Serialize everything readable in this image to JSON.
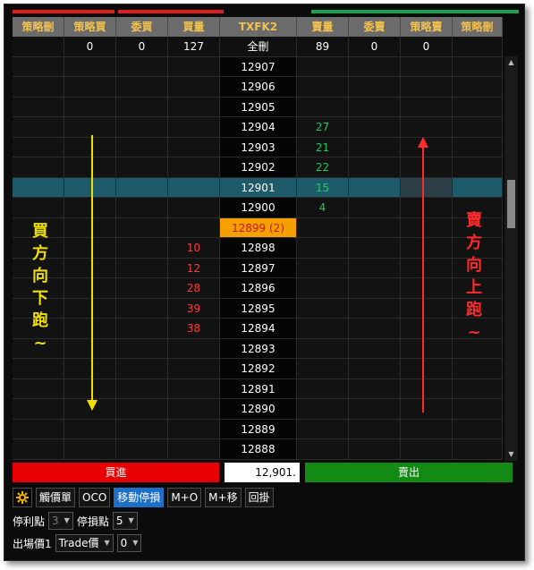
{
  "header": [
    "策略刪",
    "策略買",
    "委買",
    "買量",
    "TXFK2",
    "賣量",
    "委賣",
    "策略賣",
    "策略刪"
  ],
  "summary": [
    "",
    "0",
    "0",
    "127",
    "全刪",
    "89",
    "0",
    "0",
    ""
  ],
  "rows": [
    {
      "price": "12907",
      "bid_qty": "",
      "ask_qty": ""
    },
    {
      "price": "12906",
      "bid_qty": "",
      "ask_qty": ""
    },
    {
      "price": "12905",
      "bid_qty": "",
      "ask_qty": ""
    },
    {
      "price": "12904",
      "bid_qty": "",
      "ask_qty": "27"
    },
    {
      "price": "12903",
      "bid_qty": "",
      "ask_qty": "21"
    },
    {
      "price": "12902",
      "bid_qty": "",
      "ask_qty": "22"
    },
    {
      "price": "12901",
      "bid_qty": "",
      "ask_qty": "15"
    },
    {
      "price": "12900",
      "bid_qty": "",
      "ask_qty": "4"
    },
    {
      "price": "12899 (2)",
      "bid_qty": "",
      "ask_qty": ""
    },
    {
      "price": "12898",
      "bid_qty": "10",
      "ask_qty": ""
    },
    {
      "price": "12897",
      "bid_qty": "12",
      "ask_qty": ""
    },
    {
      "price": "12896",
      "bid_qty": "28",
      "ask_qty": ""
    },
    {
      "price": "12895",
      "bid_qty": "39",
      "ask_qty": ""
    },
    {
      "price": "12894",
      "bid_qty": "38",
      "ask_qty": ""
    },
    {
      "price": "12893",
      "bid_qty": "",
      "ask_qty": ""
    },
    {
      "price": "12892",
      "bid_qty": "",
      "ask_qty": ""
    },
    {
      "price": "12891",
      "bid_qty": "",
      "ask_qty": ""
    },
    {
      "price": "12890",
      "bid_qty": "",
      "ask_qty": ""
    },
    {
      "price": "12889",
      "bid_qty": "",
      "ask_qty": ""
    },
    {
      "price": "12888",
      "bid_qty": "",
      "ask_qty": ""
    }
  ],
  "annotations": {
    "buy_text": [
      "買",
      "方",
      "向",
      "下",
      "跑",
      "~"
    ],
    "sell_text": [
      "賣",
      "方",
      "向",
      "上",
      "跑",
      "~"
    ]
  },
  "bottom": {
    "buy_label": "買進",
    "price_value": "12,901.",
    "sell_label": "賣出",
    "tools": [
      "觸價單",
      "OCO",
      "移動停損",
      "M+O",
      "M+移",
      "回掛"
    ],
    "stop_profit_label": "停利點",
    "stop_profit_value": "3",
    "stop_loss_label": "停損點",
    "stop_loss_value": "5",
    "exit_price_label": "出場價1",
    "exit_price_type": "Trade價",
    "exit_price_offset": "0"
  },
  "icons": {
    "settings": "gear-icon",
    "scroll_up": "triangle-up-icon",
    "scroll_down": "triangle-down-icon"
  },
  "colors": {
    "buy": "#e60000",
    "sell": "#138a13",
    "bid_qty": "#ff3b3b",
    "ask_qty": "#22c55e",
    "header_text": "#f2c14e",
    "current_price_bg": "#f5a000",
    "highlight_row": "#1f5a6a"
  }
}
